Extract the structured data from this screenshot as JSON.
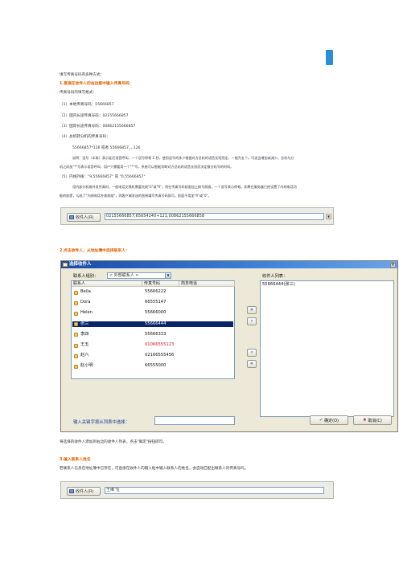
{
  "intro": "填写传真号码有多种方式：",
  "section1": {
    "heading": "1.直接在收件人的右边框中输入传真号码：",
    "sub": "传真号码的填写格式：",
    "items": [
      "（1）本地传真号码：55666857",
      "（2）国内长途传真号码：02155666857",
      "（3）国际长途传真号码：00862155666857",
      "（4）总机转分机的传真号码：",
      "55666857*126 或者 55666857,,,,126"
    ],
    "note1": "说明：逗号（半角）表示延迟语音呼叫，一个逗号停顿 2 秒。使用逗号的多少根据对方总机的语音长短而定，一般为五个。可适当增加或减少。总机与分",
    "note2": "机之间加\"*\"号表示语音呼叫，用户只需要用一个\"*\"号，系统可以智能判断对方总机的语音长短而决定拨分机号的时间。",
    "item5": "（5）内线外拨：\"9,55666857\" 或 \"0,55666857\"",
    "note3": "用内部分机拨外发传真时，一般电话交换机需要先拨\"0\"或\"9\"，则在传真号码前面加上拨号前缀，一个逗号表示停顿。如果在服务器已经设置了内线电话功",
    "note4": "能的前提，勾选了\"内线电话外拨前缀\"，则客户端发送的直接填写传真号码即可，前面不用加\"9\"或\"0\"。"
  },
  "fax_field1": {
    "button_label": "收件人(R)",
    "value": "02155666857;65654240+121;00862155666858"
  },
  "section2": {
    "heading": "2.点击收件人，从地址簿中选择联系人："
  },
  "dialog": {
    "title": "选择收件人",
    "group_label": "联系人组别：",
    "group_value": "< 外部联系人 >",
    "recipients_label": "收件人列表：",
    "columns": [
      "联系人",
      "传真号码",
      "商务电话"
    ],
    "contacts": [
      {
        "name": "Bella",
        "fax": "55666222",
        "selected": false,
        "red": false
      },
      {
        "name": "Dora",
        "fax": "66555147",
        "selected": false,
        "red": false
      },
      {
        "name": "Helen",
        "fax": "55666000",
        "selected": false,
        "red": false
      },
      {
        "name": "张三",
        "fax": "55666444",
        "selected": true,
        "red": false
      },
      {
        "name": "李四",
        "fax": "55666333",
        "selected": false,
        "red": false
      },
      {
        "name": "王五",
        "fax": "01066555123",
        "selected": false,
        "red": true
      },
      {
        "name": "赵六",
        "fax": "02166555456",
        "selected": false,
        "red": false
      },
      {
        "name": "赵小明",
        "fax": "66555000",
        "selected": false,
        "red": false
      }
    ],
    "recipients": [
      "55666444(张三)"
    ],
    "arrows": [
      "»",
      "›",
      "‹",
      "«"
    ],
    "search_label": "输入关键字按从列表中选择：",
    "ok_label": "确定(O)",
    "cancel_label": "取消(C)"
  },
  "caption2": "将选择的收件人添加到右边的收件人列表，点击\"确定\"按钮即可。",
  "section3": {
    "heading": "3.输入联系人姓名",
    "body": "若联系人信息在地址簿中已存在，可直接在收件人的输入框中输入联系人的姓名，会自动匹配出联系人的传真号码。"
  },
  "fax_field2": {
    "button_label": "收件人(R)",
    "value": "王维飞|"
  }
}
